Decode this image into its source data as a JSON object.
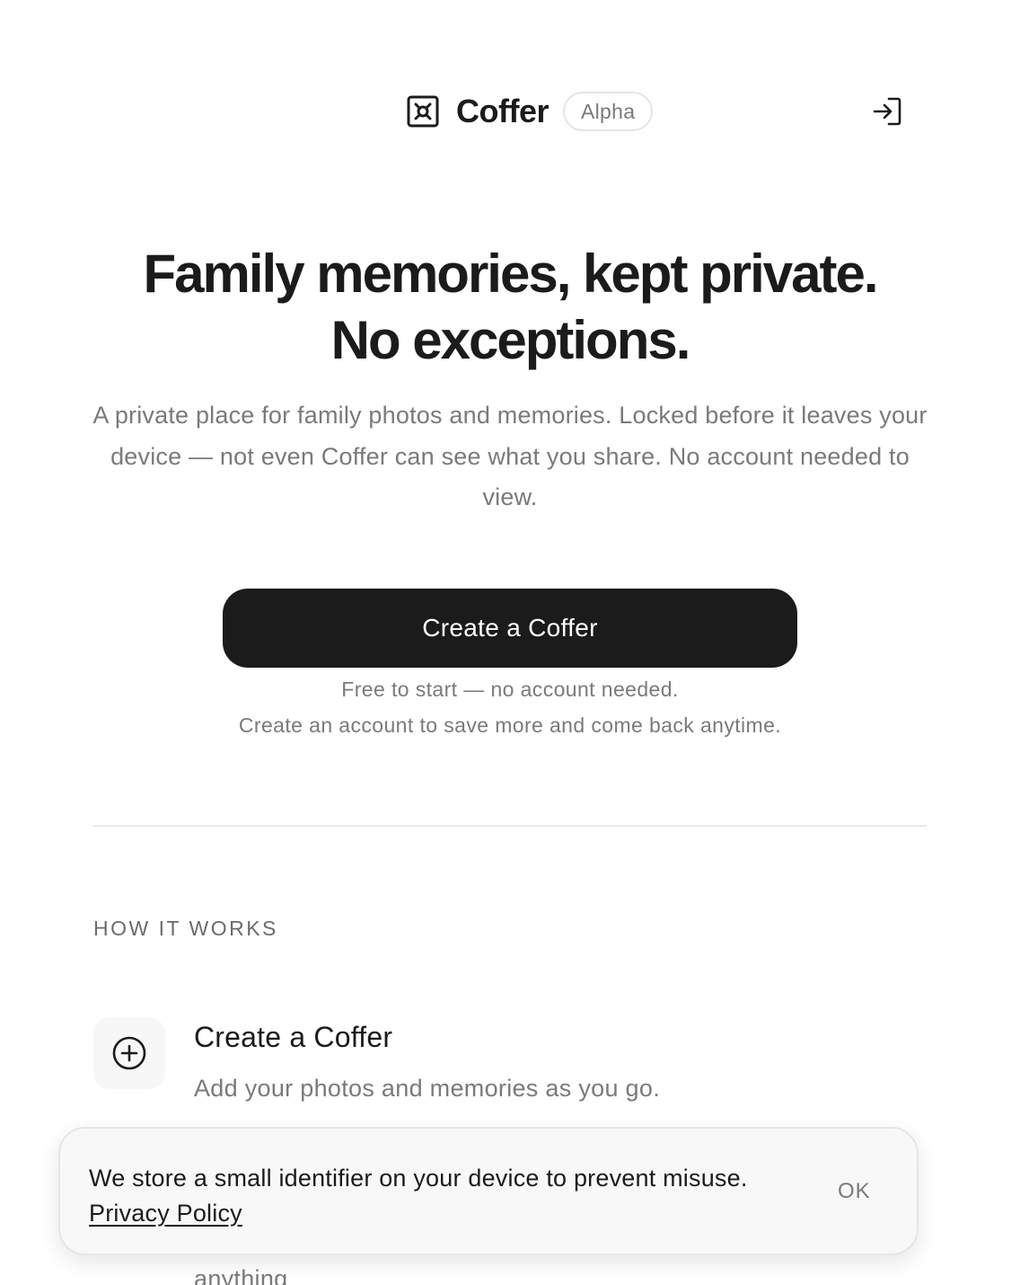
{
  "header": {
    "brand_name": "Coffer",
    "badge": "Alpha",
    "logo_icon": "coffer-logo-icon",
    "signin_icon": "sign-in-icon"
  },
  "hero": {
    "title_line1": "Family memories, kept private.",
    "title_line2": "No exceptions.",
    "description": "A private place for family photos and memories. Locked before it leaves your device — not even Coffer can see what you share. No account needed to view.",
    "cta_label": "Create a Coffer",
    "note_line1": "Free to start — no account needed.",
    "note_line2": "Create an account to save more and come back anytime."
  },
  "how_it_works": {
    "label": "HOW IT WORKS",
    "steps": [
      {
        "icon": "plus-circle-icon",
        "title": "Create a Coffer",
        "description": "Add your photos and memories as you go."
      }
    ],
    "partial_text": "anything"
  },
  "cookie_banner": {
    "message": "We store a small identifier on your device to prevent misuse.",
    "link_label": "Privacy Policy",
    "ok_label": "OK"
  },
  "colors": {
    "text_primary": "#1b1b1b",
    "text_muted": "#7a7a7a",
    "button_bg": "#1b1b1b",
    "banner_bg": "#f8f8f8"
  }
}
